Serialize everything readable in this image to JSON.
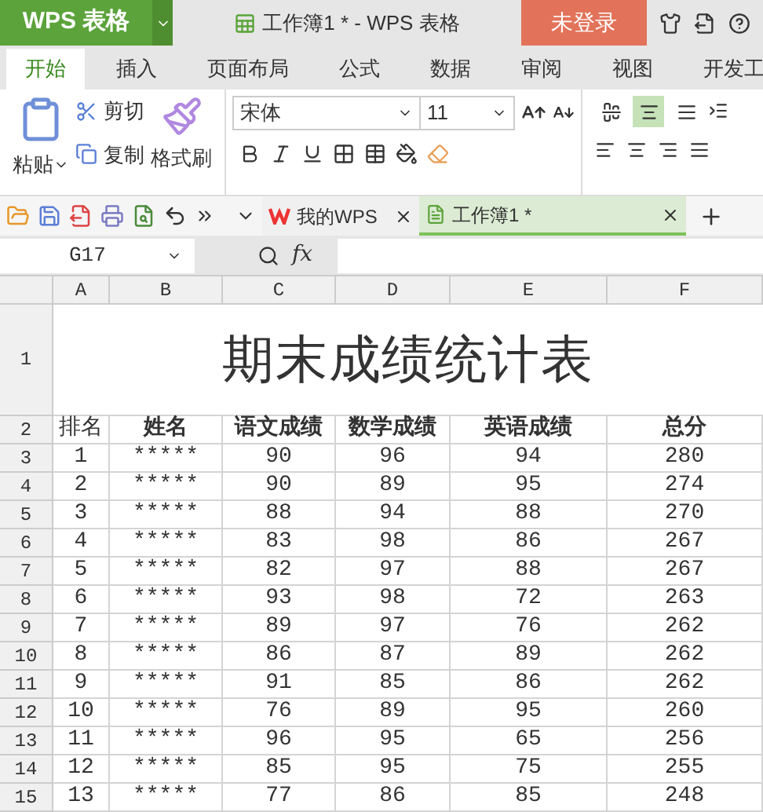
{
  "title_bar": {
    "app_button": "WPS 表格",
    "document_title": "工作簿1 * - WPS 表格",
    "login_button": "未登录"
  },
  "ribbon_tabs": [
    {
      "label": "开始",
      "selected": true
    },
    {
      "label": "插入",
      "selected": false
    },
    {
      "label": "页面布局",
      "selected": false
    },
    {
      "label": "公式",
      "selected": false
    },
    {
      "label": "数据",
      "selected": false
    },
    {
      "label": "审阅",
      "selected": false
    },
    {
      "label": "视图",
      "selected": false
    },
    {
      "label": "开发工",
      "selected": false
    }
  ],
  "ribbon": {
    "paste": "粘贴",
    "cut": "剪切",
    "copy": "复制",
    "format_painter": "格式刷",
    "font_name": "宋体",
    "font_size": "11",
    "alignment": [
      {
        "selected": false
      },
      {
        "selected": true
      },
      {
        "selected": false
      }
    ]
  },
  "doc_tabs": [
    {
      "label": "我的WPS",
      "selected": false
    },
    {
      "label": "工作簿1 *",
      "selected": true
    }
  ],
  "formula_bar": {
    "cell_ref": "G17",
    "fx": "fx"
  },
  "sheet": {
    "columns": [
      "A",
      "B",
      "C",
      "D",
      "E",
      "F"
    ],
    "title_row": "1",
    "title": "期末成绩统计表",
    "header_row": "2",
    "header": [
      "排名",
      "姓名",
      "语文成绩",
      "数学成绩",
      "英语成绩",
      "总分"
    ],
    "rows": [
      {
        "row": "3",
        "cells": [
          "1",
          "*****",
          "90",
          "96",
          "94",
          "280"
        ]
      },
      {
        "row": "4",
        "cells": [
          "2",
          "*****",
          "90",
          "89",
          "95",
          "274"
        ]
      },
      {
        "row": "5",
        "cells": [
          "3",
          "*****",
          "88",
          "94",
          "88",
          "270"
        ]
      },
      {
        "row": "6",
        "cells": [
          "4",
          "*****",
          "83",
          "98",
          "86",
          "267"
        ]
      },
      {
        "row": "7",
        "cells": [
          "5",
          "*****",
          "82",
          "97",
          "88",
          "267"
        ]
      },
      {
        "row": "8",
        "cells": [
          "6",
          "*****",
          "93",
          "98",
          "72",
          "263"
        ]
      },
      {
        "row": "9",
        "cells": [
          "7",
          "*****",
          "89",
          "97",
          "76",
          "262"
        ]
      },
      {
        "row": "10",
        "cells": [
          "8",
          "*****",
          "86",
          "87",
          "89",
          "262"
        ]
      },
      {
        "row": "11",
        "cells": [
          "9",
          "*****",
          "91",
          "85",
          "86",
          "262"
        ]
      },
      {
        "row": "12",
        "cells": [
          "10",
          "*****",
          "76",
          "89",
          "95",
          "260"
        ]
      },
      {
        "row": "13",
        "cells": [
          "11",
          "*****",
          "96",
          "95",
          "65",
          "256"
        ]
      },
      {
        "row": "14",
        "cells": [
          "12",
          "*****",
          "85",
          "95",
          "75",
          "255"
        ]
      },
      {
        "row": "15",
        "cells": [
          "13",
          "*****",
          "77",
          "86",
          "85",
          "248"
        ]
      }
    ]
  }
}
